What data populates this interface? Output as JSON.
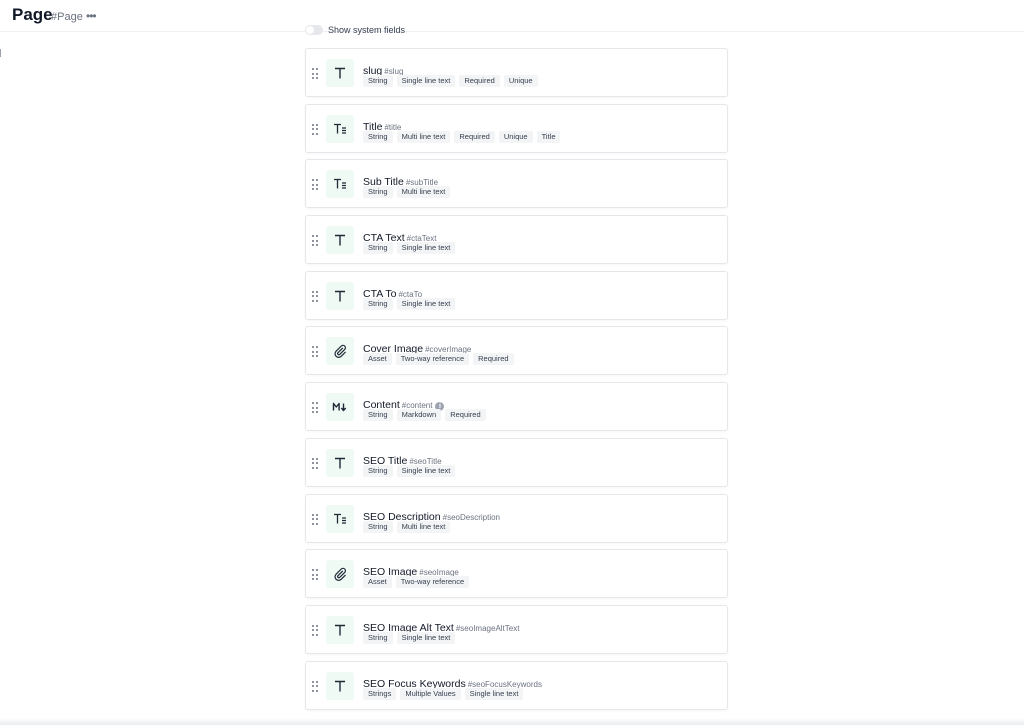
{
  "header": {
    "title": "Page",
    "api_id": "#Page",
    "more_label": "•••"
  },
  "system_fields": {
    "label": "Show system fields",
    "enabled": false
  },
  "fields": [
    {
      "name": "slug",
      "api_id": "#slug",
      "icon": "text-t-icon",
      "tags": [
        "String",
        "Single line text",
        "Required",
        "Unique"
      ]
    },
    {
      "name": "Title",
      "api_id": "#title",
      "icon": "multiline-text-icon",
      "tags": [
        "String",
        "Multi line text",
        "Required",
        "Unique",
        "Title"
      ]
    },
    {
      "name": "Sub Title",
      "api_id": "#subTitle",
      "icon": "multiline-text-icon",
      "tags": [
        "String",
        "Multi line text"
      ]
    },
    {
      "name": "CTA Text",
      "api_id": "#ctaText",
      "icon": "text-t-icon",
      "tags": [
        "String",
        "Single line text"
      ]
    },
    {
      "name": "CTA To",
      "api_id": "#ctaTo",
      "icon": "text-t-icon",
      "tags": [
        "String",
        "Single line text"
      ]
    },
    {
      "name": "Cover Image",
      "api_id": "#coverImage",
      "icon": "paperclip-icon",
      "tags": [
        "Asset",
        "Two-way reference",
        "Required"
      ]
    },
    {
      "name": "Content",
      "api_id": "#content",
      "icon": "markdown-icon",
      "info": true,
      "tags": [
        "String",
        "Markdown",
        "Required"
      ]
    },
    {
      "name": "SEO Title",
      "api_id": "#seoTitle",
      "icon": "text-t-icon",
      "tags": [
        "String",
        "Single line text"
      ]
    },
    {
      "name": "SEO Description",
      "api_id": "#seoDescription",
      "icon": "multiline-text-icon",
      "tags": [
        "String",
        "Multi line text"
      ]
    },
    {
      "name": "SEO Image",
      "api_id": "#seoImage",
      "icon": "paperclip-icon",
      "tags": [
        "Asset",
        "Two-way reference"
      ]
    },
    {
      "name": "SEO Image Alt Text",
      "api_id": "#seoImageAltText",
      "icon": "text-t-icon",
      "tags": [
        "String",
        "Single line text"
      ]
    },
    {
      "name": "SEO Focus Keywords",
      "api_id": "#seoFocusKeywords",
      "icon": "text-t-icon",
      "tags": [
        "Strings",
        "Multiple Values",
        "Single line text"
      ]
    }
  ],
  "colors": {
    "icon_bg": "#eefaf3",
    "tag_bg": "#f3f4f6",
    "card_border": "#e5e7eb"
  }
}
